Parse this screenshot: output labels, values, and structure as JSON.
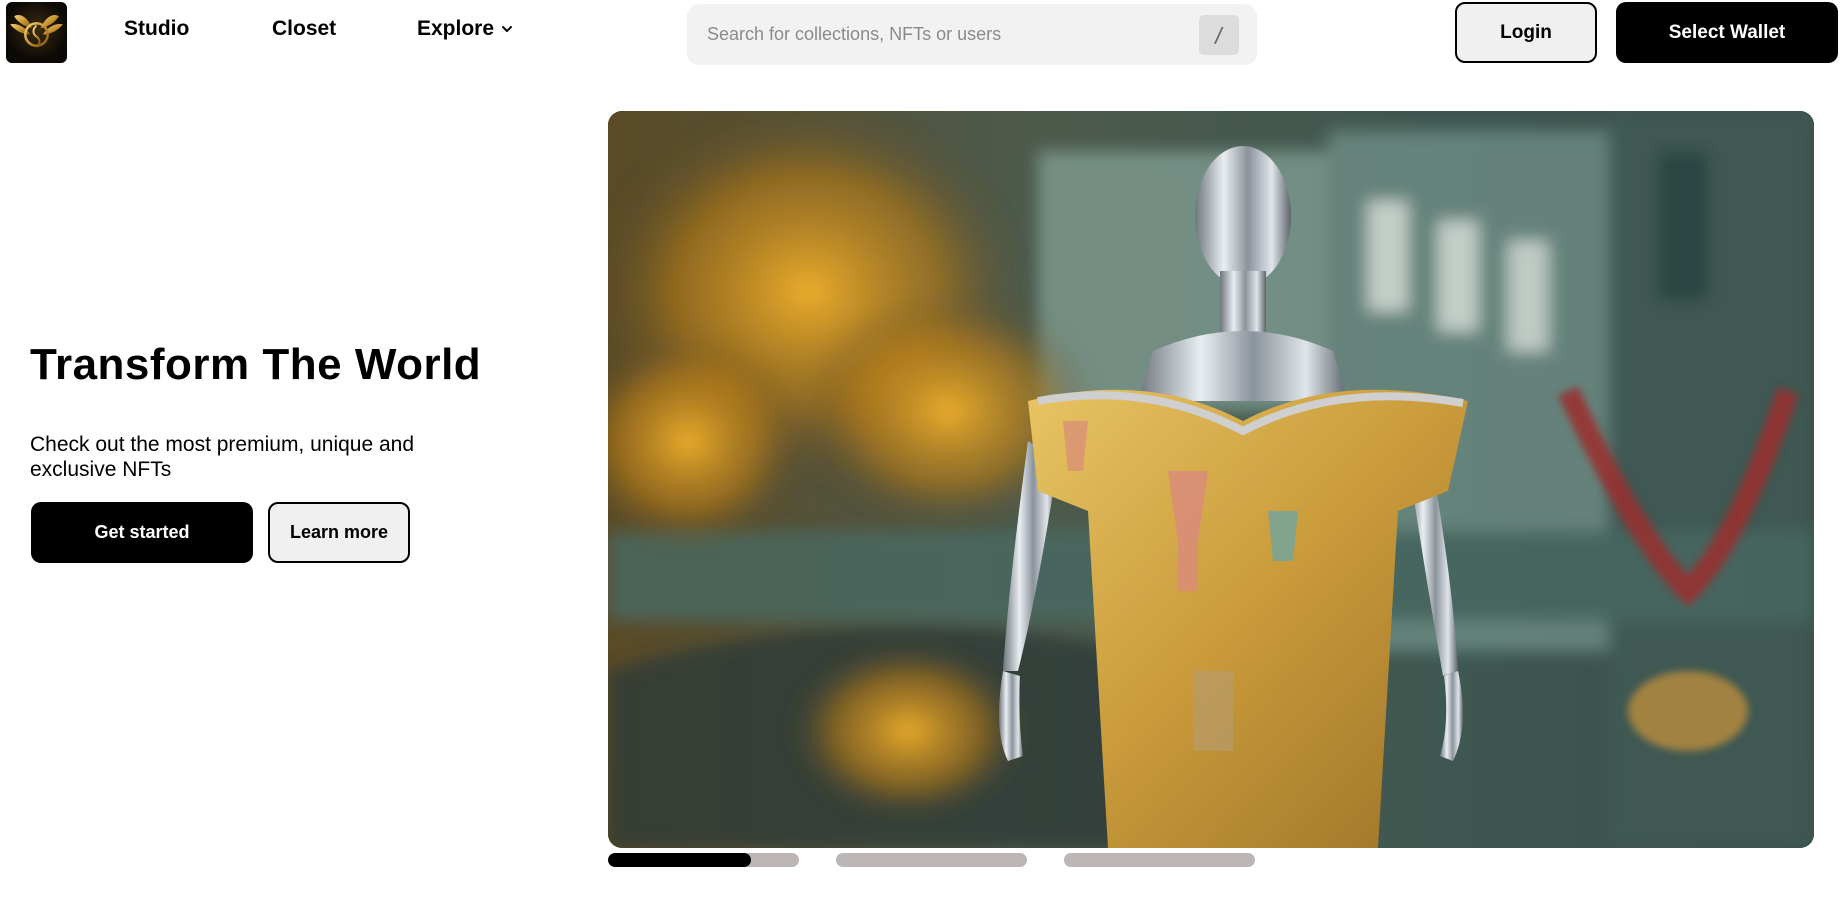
{
  "header": {
    "nav": {
      "studio": "Studio",
      "closet": "Closet",
      "explore": "Explore"
    },
    "search": {
      "placeholder": "Search for collections, NFTs or users",
      "shortcut": "/"
    },
    "login_label": "Login",
    "wallet_label": "Select Wallet"
  },
  "hero": {
    "title": "Transform The World",
    "subtitle": "Check out the most premium, unique and exclusive NFTs",
    "get_started_label": "Get started",
    "learn_more_label": "Learn more"
  },
  "carousel": {
    "slide_count": 3,
    "active_index": 0,
    "active_progress": 0.75
  },
  "icons": {
    "logo": "winged-coin-logo-icon",
    "explore_chevron": "chevron-down-icon"
  },
  "colors": {
    "primary": "#000000",
    "search_bg": "#f2f2f2",
    "secondary_button_bg": "#f0f0f0",
    "carousel_inactive": "#bdb6b6"
  }
}
